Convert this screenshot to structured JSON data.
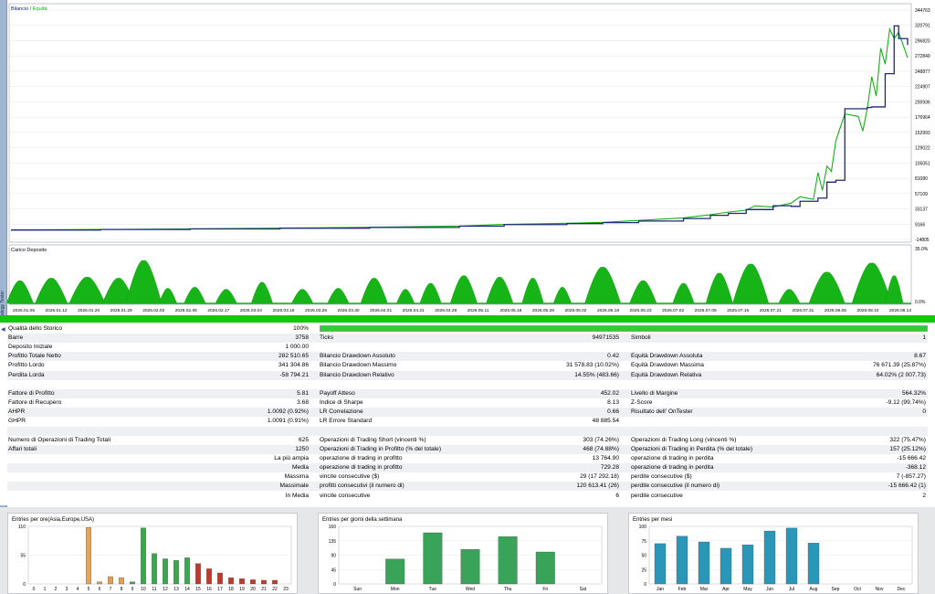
{
  "left_strip": {
    "label": "Strategy Tester"
  },
  "balance_chart": {
    "legend_balance": "Bilancio",
    "legend_sep": "/",
    "legend_equity": "Equità",
    "colors": {
      "balance": "#1b2a78",
      "equity": "#16b016",
      "grid": "#d9dde3"
    },
    "y_labels": [
      "344763",
      "320791",
      "296820",
      "272849",
      "248877",
      "224907",
      "200936",
      "176964",
      "152993",
      "129022",
      "105051",
      "81080",
      "57109",
      "33137",
      "9166",
      "-14805"
    ],
    "balance": [
      [
        0,
        0
      ],
      [
        0.1,
        800
      ],
      [
        0.2,
        1700
      ],
      [
        0.3,
        2800
      ],
      [
        0.4,
        4000
      ],
      [
        0.5,
        6000
      ],
      [
        0.55,
        8500
      ],
      [
        0.62,
        10000
      ],
      [
        0.66,
        11500
      ],
      [
        0.7,
        14000
      ],
      [
        0.75,
        18000
      ],
      [
        0.78,
        23000
      ],
      [
        0.8,
        26000
      ],
      [
        0.82,
        32000
      ],
      [
        0.85,
        38000
      ],
      [
        0.87,
        37000
      ],
      [
        0.88,
        45000
      ],
      [
        0.9,
        50000
      ],
      [
        0.91,
        75000
      ],
      [
        0.92,
        78000
      ],
      [
        0.93,
        190000
      ],
      [
        0.955,
        192000
      ],
      [
        0.96,
        193000
      ],
      [
        0.975,
        245000
      ],
      [
        0.985,
        320000
      ],
      [
        0.99,
        300000
      ],
      [
        1,
        290000
      ]
    ],
    "equity": [
      [
        0,
        0
      ],
      [
        0.1,
        800
      ],
      [
        0.2,
        1700
      ],
      [
        0.3,
        2900
      ],
      [
        0.4,
        4200
      ],
      [
        0.5,
        6200
      ],
      [
        0.55,
        8800
      ],
      [
        0.62,
        10500
      ],
      [
        0.66,
        12000
      ],
      [
        0.7,
        15000
      ],
      [
        0.75,
        19000
      ],
      [
        0.78,
        24000
      ],
      [
        0.8,
        28000
      ],
      [
        0.82,
        31000
      ],
      [
        0.83,
        38000
      ],
      [
        0.85,
        36000
      ],
      [
        0.87,
        42000
      ],
      [
        0.88,
        52000
      ],
      [
        0.895,
        48000
      ],
      [
        0.9,
        90000
      ],
      [
        0.905,
        62000
      ],
      [
        0.91,
        100000
      ],
      [
        0.915,
        92000
      ],
      [
        0.92,
        140000
      ],
      [
        0.93,
        182000
      ],
      [
        0.945,
        178000
      ],
      [
        0.95,
        155000
      ],
      [
        0.955,
        190000
      ],
      [
        0.96,
        240000
      ],
      [
        0.965,
        210000
      ],
      [
        0.97,
        285000
      ],
      [
        0.975,
        260000
      ],
      [
        0.98,
        315000
      ],
      [
        0.985,
        300000
      ],
      [
        0.99,
        310000
      ],
      [
        1,
        270000
      ]
    ]
  },
  "load_chart": {
    "title": "Carico Deposito",
    "y_labels": [
      "35.0%",
      "0.0%"
    ],
    "x_labels": [
      "2026.01.05",
      "2026.01.12",
      "2026.01.20",
      "2026.01.29",
      "2026.02.03",
      "2026.02.06",
      "2026.02.17",
      "2026.03.04",
      "2026.03.16",
      "2026.03.26",
      "2026.03.30",
      "2026.04.01",
      "2026.04.21",
      "2026.04.29",
      "2026.05.11",
      "2026.05.18",
      "2026.05.28",
      "2026.06.02",
      "2026.06.18",
      "2026.06.23",
      "2026.07.02",
      "2026.07.09",
      "2026.07.16",
      "2026.07.21",
      "2026.07.31",
      "2026.08.05",
      "2026.08.10",
      "2026.08.13"
    ],
    "color": "#16b416",
    "peaks": [
      {
        "x": 0.01,
        "h": 0.45,
        "w": 0.015
      },
      {
        "x": 0.045,
        "h": 0.5,
        "w": 0.018
      },
      {
        "x": 0.085,
        "h": 0.52,
        "w": 0.02
      },
      {
        "x": 0.12,
        "h": 0.5,
        "w": 0.018
      },
      {
        "x": 0.148,
        "h": 0.85,
        "w": 0.02
      },
      {
        "x": 0.175,
        "h": 0.3,
        "w": 0.01
      },
      {
        "x": 0.205,
        "h": 0.32,
        "w": 0.012
      },
      {
        "x": 0.24,
        "h": 0.28,
        "w": 0.012
      },
      {
        "x": 0.28,
        "h": 0.42,
        "w": 0.012
      },
      {
        "x": 0.325,
        "h": 0.28,
        "w": 0.012
      },
      {
        "x": 0.365,
        "h": 0.3,
        "w": 0.012
      },
      {
        "x": 0.405,
        "h": 0.5,
        "w": 0.015
      },
      {
        "x": 0.44,
        "h": 0.28,
        "w": 0.01
      },
      {
        "x": 0.468,
        "h": 0.4,
        "w": 0.012
      },
      {
        "x": 0.505,
        "h": 0.55,
        "w": 0.015
      },
      {
        "x": 0.545,
        "h": 0.52,
        "w": 0.015
      },
      {
        "x": 0.582,
        "h": 0.5,
        "w": 0.012
      },
      {
        "x": 0.615,
        "h": 0.32,
        "w": 0.01
      },
      {
        "x": 0.66,
        "h": 0.72,
        "w": 0.02
      },
      {
        "x": 0.705,
        "h": 0.45,
        "w": 0.015
      },
      {
        "x": 0.75,
        "h": 0.4,
        "w": 0.012
      },
      {
        "x": 0.79,
        "h": 0.6,
        "w": 0.015
      },
      {
        "x": 0.825,
        "h": 0.78,
        "w": 0.02
      },
      {
        "x": 0.868,
        "h": 0.28,
        "w": 0.012
      },
      {
        "x": 0.91,
        "h": 0.62,
        "w": 0.02
      },
      {
        "x": 0.96,
        "h": 0.8,
        "w": 0.022
      },
      {
        "x": 0.985,
        "h": 0.55,
        "w": 0.01
      }
    ]
  },
  "report": {
    "quality_label": "Qualità dello Storico",
    "quality_value": "100%",
    "rows": [
      {
        "cells": [
          [
            "Barre",
            "3758"
          ],
          [
            "Ticks",
            "94971535"
          ],
          [
            "Simboli",
            "1"
          ]
        ]
      },
      {
        "cells": [
          [
            "Deposito Iniziale",
            "1 000.00"
          ],
          [
            "",
            ""
          ],
          [
            "",
            ""
          ]
        ]
      },
      {
        "cells": [
          [
            "Profitto Totale Netto",
            "282 510.65"
          ],
          [
            "Bilancio Drawdown Assoluto",
            "0.42"
          ],
          [
            "Equità Drawdown Assoluta",
            "8.67"
          ]
        ]
      },
      {
        "cells": [
          [
            "Profitto Lordo",
            "341 304.86"
          ],
          [
            "Bilancio Drawdown Massimo",
            "31 578.83 (10.02%)"
          ],
          [
            "Equità Drawdown Massima",
            "76 671.39 (25.87%)"
          ]
        ]
      },
      {
        "cells": [
          [
            "Perdita Lorda",
            "-58 794.21"
          ],
          [
            "Bilancio Drawdown Relativo",
            "14.55% (483.66)"
          ],
          [
            "Equità Drawdown Relativa",
            "64.02% (2 007.73)"
          ]
        ]
      },
      {
        "cells": [
          [
            "",
            ""
          ],
          [
            "",
            ""
          ],
          [
            "",
            ""
          ]
        ]
      },
      {
        "cells": [
          [
            "Fattore di Profitto",
            "5.81"
          ],
          [
            "Payoff Atteso",
            "452.02"
          ],
          [
            "Livello di Margine",
            "564.32%"
          ]
        ]
      },
      {
        "cells": [
          [
            "Fattore di Recupero",
            "3.68"
          ],
          [
            "Indice di Sharpe",
            "8.13"
          ],
          [
            "Z-Score",
            "-9.12 (99.74%)"
          ]
        ]
      },
      {
        "cells": [
          [
            "AHPR",
            "1.0092 (0.92%)"
          ],
          [
            "LR Correlazione",
            "0.66"
          ],
          [
            "Risultato dell' OnTester",
            "0"
          ]
        ]
      },
      {
        "cells": [
          [
            "GHPR",
            "1.0091 (0.91%)"
          ],
          [
            "LR Errore Standard",
            "48 885.54"
          ],
          [
            "",
            ""
          ]
        ]
      },
      {
        "cells": [
          [
            "",
            ""
          ],
          [
            "",
            ""
          ],
          [
            "",
            ""
          ]
        ]
      },
      {
        "cells": [
          [
            "Numero di Operazioni di Trading Totali",
            "625"
          ],
          [
            "Operazioni di Trading Short (vincenti %)",
            "303 (74.26%)"
          ],
          [
            "Operazioni di Trading Long (vincenti %)",
            "322 (75.47%)"
          ]
        ]
      },
      {
        "cells": [
          [
            "Affari totali",
            "1250"
          ],
          [
            "Operazioni di Trading in Profitto (% del totale)",
            "468 (74.88%)"
          ],
          [
            "Operazioni di Trading in Perdita (% del totale)",
            "157 (25.12%)"
          ]
        ]
      },
      {
        "right1": true,
        "cells": [
          [
            "La più ampia",
            ""
          ],
          [
            "operazione di trading in profitto",
            "13 764.90"
          ],
          [
            "operazione di trading in perdita",
            "-15 666.42"
          ]
        ]
      },
      {
        "right1": true,
        "cells": [
          [
            "Media",
            ""
          ],
          [
            "operazione di trading in profitto",
            "729.28"
          ],
          [
            "operazione di trading in perdita",
            "-368.12"
          ]
        ]
      },
      {
        "right1": true,
        "cells": [
          [
            "Massima",
            ""
          ],
          [
            "vincite consecutive ($)",
            "29 (17 292.18)"
          ],
          [
            "perdite consecutive ($)",
            "7 (-857.27)"
          ]
        ]
      },
      {
        "right1": true,
        "cells": [
          [
            "Massimale",
            ""
          ],
          [
            "profitti consecutivi (il numero di)",
            "120 613.41 (26)"
          ],
          [
            "perdite consecutive (il numero di)",
            "-15 666.42 (1)"
          ]
        ]
      },
      {
        "right1": true,
        "cells": [
          [
            "In Media",
            ""
          ],
          [
            "vincite consecutive",
            "6"
          ],
          [
            "perdite consecutive",
            "2"
          ]
        ]
      }
    ]
  },
  "histograms": {
    "hours": {
      "title": "Entries per ore(Asia,Europe,USA)",
      "y_labels": [
        "110",
        "55",
        "0"
      ],
      "ymax": 110,
      "x_labels": [
        "0",
        "1",
        "2",
        "3",
        "4",
        "5",
        "6",
        "7",
        "8",
        "9",
        "10",
        "11",
        "12",
        "13",
        "14",
        "15",
        "16",
        "17",
        "18",
        "19",
        "20",
        "21",
        "22",
        "23"
      ],
      "values": [
        0,
        0,
        0,
        0,
        0,
        108,
        4,
        14,
        12,
        4,
        107,
        58,
        48,
        45,
        50,
        39,
        29,
        21,
        12,
        10,
        8,
        7,
        7,
        0
      ],
      "colors": [
        "#e0a050",
        "#e0a050",
        "#e0a050",
        "#e0a050",
        "#e0a050",
        "#e6a455",
        "#e0a050",
        "#e0a050",
        "#e0a050",
        "#3aa84a",
        "#3aa84a",
        "#3aa84a",
        "#3aa84a",
        "#3aa84a",
        "#3aa84a",
        "#c0392b",
        "#c0392b",
        "#c0392b",
        "#c0392b",
        "#c0392b",
        "#c0392b",
        "#c0392b",
        "#c0392b",
        "#c0392b"
      ]
    },
    "weekdays": {
      "title": "Entries per giorni della settimana",
      "y_labels": [
        "160",
        "135",
        "90",
        "45",
        "0"
      ],
      "ymax": 180,
      "x_labels": [
        "Sun",
        "Mon",
        "Tue",
        "Wed",
        "Thu",
        "Fri",
        "Sat"
      ],
      "values": [
        0,
        78,
        160,
        108,
        148,
        100,
        0
      ],
      "color": "#3aa35a"
    },
    "months": {
      "title": "Entries per mesi",
      "y_labels": [
        "100",
        "75",
        "50",
        "25",
        "0"
      ],
      "ymax": 100,
      "x_labels": [
        "Jan",
        "Feb",
        "Mar",
        "Apr",
        "May",
        "Jun",
        "Jul",
        "Aug",
        "Sep",
        "Oct",
        "Nov",
        "Dec"
      ],
      "values": [
        70,
        83,
        73,
        62,
        68,
        92,
        97,
        71,
        0,
        0,
        0,
        0
      ],
      "color": "#2a96b8"
    }
  }
}
